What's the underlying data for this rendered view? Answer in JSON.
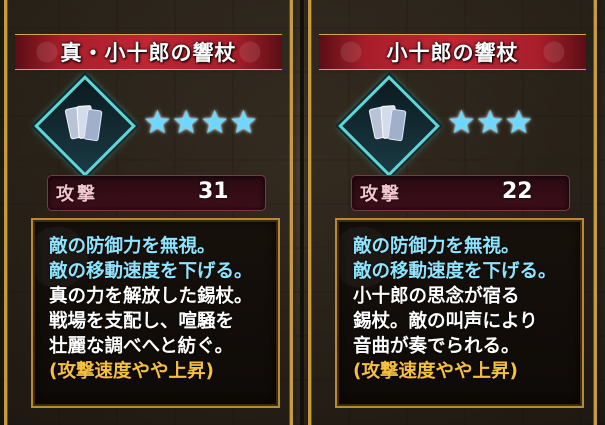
{
  "colors": {
    "frame_gold": "#c79a3e",
    "banner_red": "#c02634",
    "effect_cyan": "#8fe4ff",
    "lore_white": "#ffffff",
    "note_yellow": "#f5c040",
    "star_blue": "#6fd7ff"
  },
  "cards": [
    {
      "title": "真・小十郎の響杖",
      "icon": "staff-weapon-icon",
      "rarity_stars": 4,
      "star_glyphs": "★★★★",
      "stat_label": "攻撃",
      "stat_value": "31",
      "effects": [
        "敵の防御力を無視。",
        "敵の移動速度を下げる。"
      ],
      "lore": [
        "真の力を解放した錫杖。",
        "戦場を支配し、喧騒を",
        "壮麗な調べへと紡ぐ。"
      ],
      "note": "(攻撃速度やや上昇)"
    },
    {
      "title": "小十郎の響杖",
      "icon": "staff-weapon-icon",
      "rarity_stars": 3,
      "star_glyphs": "★★★",
      "stat_label": "攻撃",
      "stat_value": "22",
      "effects": [
        "敵の防御力を無視。",
        "敵の移動速度を下げる。"
      ],
      "lore": [
        "小十郎の思念が宿る",
        "錫杖。敵の叫声により",
        "音曲が奏でられる。"
      ],
      "note": "(攻撃速度やや上昇)"
    }
  ]
}
